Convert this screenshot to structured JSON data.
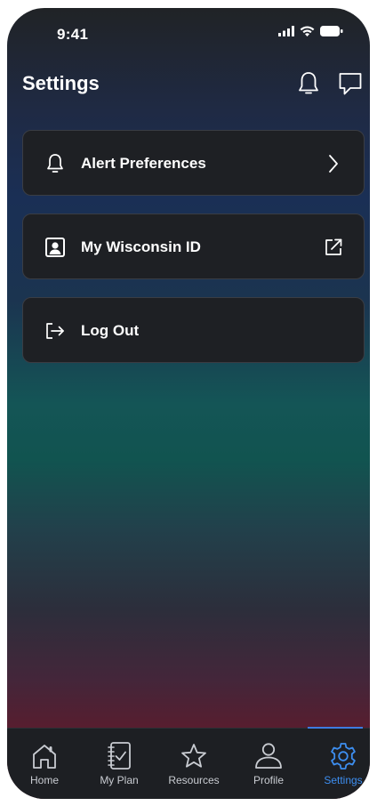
{
  "status_bar": {
    "time": "9:41"
  },
  "header": {
    "title": "Settings"
  },
  "menu": [
    {
      "label": "Alert Preferences",
      "icon": "bell-icon",
      "trailing": "chevron-right-icon"
    },
    {
      "label": "My Wisconsin ID",
      "icon": "id-card-icon",
      "trailing": "external-link-icon"
    },
    {
      "label": "Log Out",
      "icon": "logout-icon"
    }
  ],
  "tabs": [
    {
      "label": "Home",
      "icon": "home-icon"
    },
    {
      "label": "My Plan",
      "icon": "plan-notebook-icon"
    },
    {
      "label": "Resources",
      "icon": "star-icon"
    },
    {
      "label": "Profile",
      "icon": "person-icon"
    },
    {
      "label": "Settings",
      "icon": "gear-icon",
      "active": true
    }
  ],
  "colors": {
    "accent": "#3d8ef0",
    "card_background": "#1e2024",
    "tab_bar_background": "#1d1f23"
  }
}
